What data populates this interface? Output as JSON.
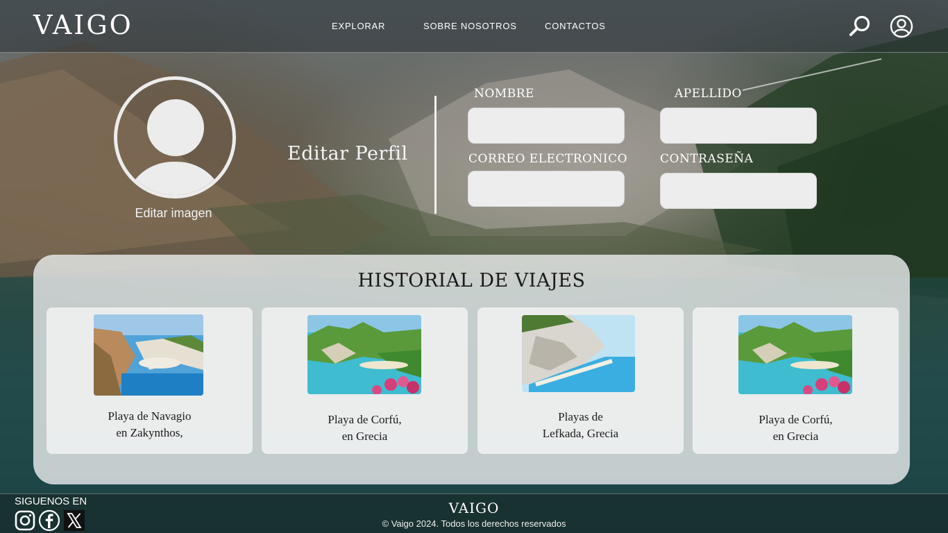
{
  "header": {
    "logo": "VAIGO",
    "nav": [
      "EXPLORAR",
      "SOBRE NOSOTROS",
      "CONTACTOS"
    ],
    "icons": [
      "search-icon",
      "user-icon"
    ]
  },
  "profile": {
    "edit_image_label": "Editar imagen",
    "title": "Editar Perfil",
    "fields": {
      "nombre": {
        "label": "NOMBRE",
        "value": ""
      },
      "apellido": {
        "label": "APELLIDO",
        "value": ""
      },
      "correo": {
        "label": "CORREO ELECTRONICO",
        "value": ""
      },
      "contrasena": {
        "label": "CONTRASEÑA",
        "value": ""
      }
    }
  },
  "history": {
    "title": "HISTORIAL DE VIAJES",
    "trips": [
      {
        "line1": "Playa de Navagio",
        "line2": "en Zakynthos,"
      },
      {
        "line1": "Playa de Corfú,",
        "line2": "en Grecia"
      },
      {
        "line1": "Playas de",
        "line2": "Lefkada, Grecia"
      },
      {
        "line1": "Playa de Corfú,",
        "line2": "en Grecia"
      }
    ]
  },
  "footer": {
    "follow_label": "SIGUENOS EN",
    "social": [
      "instagram-icon",
      "facebook-icon",
      "x-icon"
    ],
    "logo": "VAIGO",
    "copyright": "© Vaigo 2024. Todos los derechos reservados"
  },
  "colors": {
    "panel": "#e8eaea",
    "input": "#ededed",
    "text_dark": "#1a1a1a"
  }
}
